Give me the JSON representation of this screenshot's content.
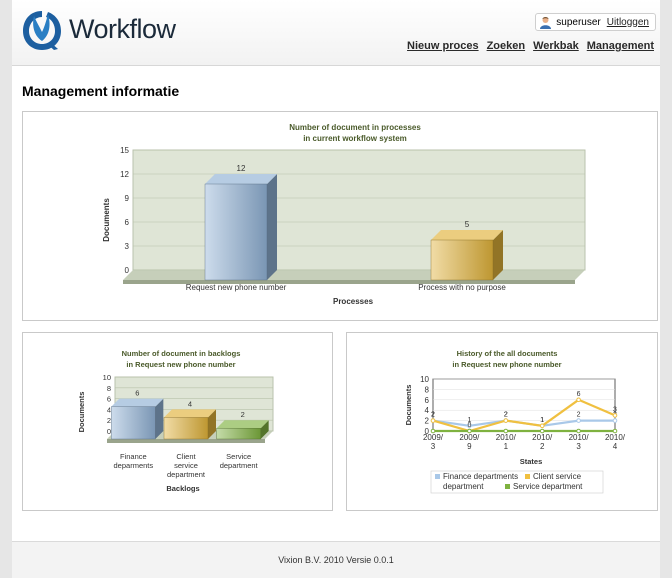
{
  "header": {
    "logo_text": "Workflow",
    "user": {
      "name": "superuser",
      "logout_label": "Uitloggen"
    },
    "nav": [
      "Nieuw proces",
      "Zoeken",
      "Werkbak",
      "Management"
    ]
  },
  "page_title": "Management informatie",
  "footer_text": "Vixion B.V. 2010 Versie 0.0.1",
  "chart_data": [
    {
      "type": "bar",
      "title": "Number of document in processes",
      "subtitle": "in current workflow system",
      "xlabel": "Processes",
      "ylabel": "Documents",
      "categories": [
        "Request new phone number",
        "Process with no purpose"
      ],
      "values": [
        12,
        5
      ],
      "colors": [
        "#8fb1d4",
        "#e0b23a"
      ],
      "ylim": [
        0,
        15
      ],
      "yticks": [
        0,
        3,
        6,
        9,
        12,
        15
      ]
    },
    {
      "type": "bar",
      "title": "Number of document in backlogs",
      "subtitle": "in Request new phone number",
      "xlabel": "Backlogs",
      "ylabel": "Documents",
      "categories": [
        "Finance deparments",
        "Client service department",
        "Service department"
      ],
      "category_lines": [
        [
          "Finance",
          "deparments"
        ],
        [
          "Client",
          "service",
          "department"
        ],
        [
          "Service",
          "department"
        ]
      ],
      "values": [
        6,
        4,
        2
      ],
      "colors": [
        "#8fb1d4",
        "#e0b23a",
        "#7fb240"
      ],
      "ylim": [
        0,
        10
      ],
      "yticks": [
        0,
        2,
        4,
        6,
        8,
        10
      ]
    },
    {
      "type": "line",
      "title": "History of the all documents",
      "subtitle": "in Request new phone number",
      "xlabel": "States",
      "ylabel": "Documents",
      "x": [
        "2009/3",
        "2009/9",
        "2010/1",
        "2010/2",
        "2010/3",
        "2010/4"
      ],
      "x_lines": [
        [
          "2009/",
          "3"
        ],
        [
          "2009/",
          "9"
        ],
        [
          "2010/",
          "1"
        ],
        [
          "2010/",
          "2"
        ],
        [
          "2010/",
          "3"
        ],
        [
          "2010/",
          "4"
        ]
      ],
      "ylim": [
        0,
        10
      ],
      "yticks": [
        0,
        2,
        4,
        6,
        8,
        10
      ],
      "series": [
        {
          "name": "Finance departments",
          "color": "#a9c8e8",
          "values": [
            2,
            1,
            2,
            1,
            2,
            2
          ]
        },
        {
          "name": "Client service department",
          "color": "#f0c040",
          "values": [
            2,
            0,
            2,
            1,
            6,
            3
          ]
        },
        {
          "name": "Service department",
          "color": "#7fb240",
          "values": [
            0,
            0,
            0,
            0,
            0,
            0
          ]
        }
      ],
      "legend_lines": [
        [
          "Finance departments",
          "Client service"
        ],
        [
          "department",
          "Service department"
        ]
      ]
    }
  ]
}
